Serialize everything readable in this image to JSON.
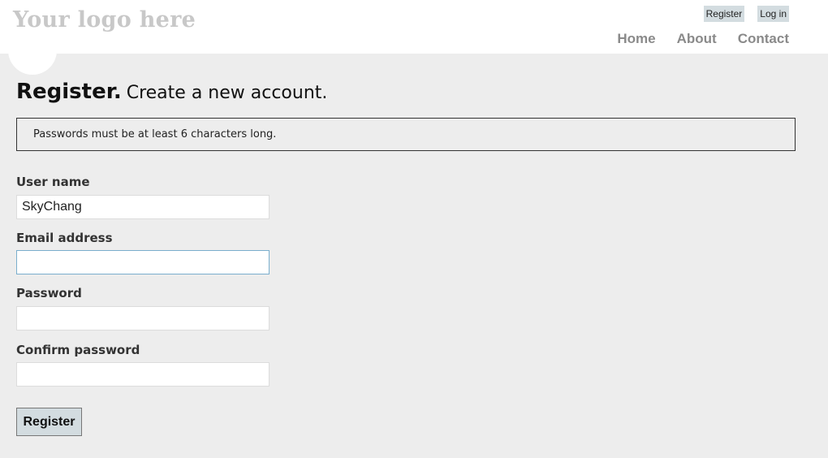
{
  "header": {
    "logo": "Your logo here",
    "login": {
      "register_label": "Register",
      "login_label": "Log in"
    },
    "nav": {
      "items": [
        "Home",
        "About",
        "Contact"
      ]
    }
  },
  "main": {
    "title_strong": "Register.",
    "title_sub": "Create a new account.",
    "notice": "Passwords must be at least 6 characters long.",
    "form": {
      "username_label": "User name",
      "username_value": "SkyChang",
      "email_label": "Email address",
      "email_value": "",
      "password_label": "Password",
      "password_value": "",
      "confirm_label": "Confirm password",
      "confirm_value": "",
      "submit_label": "Register"
    }
  },
  "colors": {
    "header_bg": "#ffffff",
    "page_bg": "#ededed",
    "button_bg": "#d3dce0",
    "nav_text": "#8a8a8a",
    "logo_text": "#c8c8c8",
    "focus_border": "#7aaecd"
  }
}
